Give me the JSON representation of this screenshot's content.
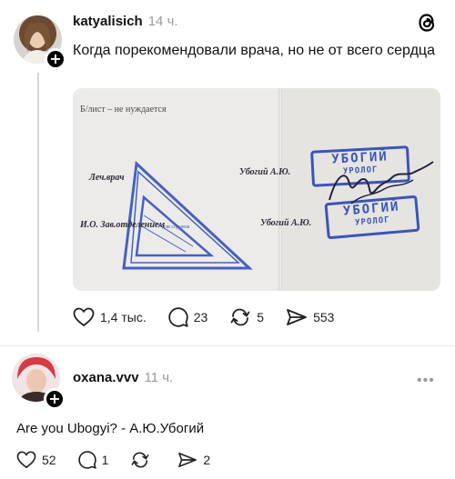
{
  "post": {
    "username": "katyalisich",
    "time": "14 ч.",
    "text": "Когда порекомендовали врача, но не от всего сердца",
    "image": {
      "header_text": "Б/лист – не нуждается",
      "left_label_1": "Леч.врач",
      "left_label_2": "И.О. Зав.отделением",
      "right_label_1": "Убогий А.Ю.",
      "right_label_2": "Убогий А.Ю.",
      "stamp_big": "УБОГИЙ",
      "stamp_small": "УРОЛОГ",
      "triangle_small_text": "для справок"
    },
    "actions": {
      "likes": "1,4 тыс.",
      "comments": "23",
      "reposts": "5",
      "shares": "553"
    }
  },
  "comment": {
    "username": "oxana.vvv",
    "time": "11 ч.",
    "text": "Are you Ubogyi? - А.Ю.Убогий",
    "actions": {
      "likes": "52",
      "comments": "1",
      "reposts": "",
      "shares": "2"
    }
  },
  "colors": {
    "stamp": "#3b55b8",
    "muted": "#9a9a9a"
  }
}
